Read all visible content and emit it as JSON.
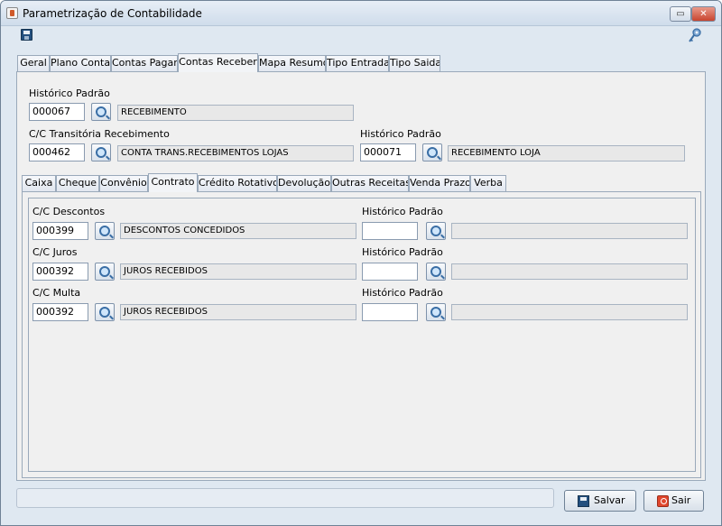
{
  "window": {
    "title": "Parametrização de Contabilidade",
    "minimize_label": "▭",
    "close_label": "✕"
  },
  "toolbar": {
    "save_icon": "save-icon",
    "key_icon": "key-icon"
  },
  "main_tabs": [
    {
      "label": "Geral"
    },
    {
      "label": "Plano Conta"
    },
    {
      "label": "Contas Pagar"
    },
    {
      "label": "Contas Receber"
    },
    {
      "label": "Mapa Resumo"
    },
    {
      "label": "Tipo Entrada"
    },
    {
      "label": "Tipo Saida"
    }
  ],
  "active_main_tab": "Contas Receber",
  "contas_receber": {
    "historico_padrao": {
      "label": "Histórico Padrão",
      "code": "000067",
      "description": "RECEBIMENTO"
    },
    "cc_transitoria": {
      "label": "C/C Transitória Recebimento",
      "code": "000462",
      "description": "CONTA TRANS.RECEBIMENTOS LOJAS"
    },
    "historico_transitoria": {
      "label": "Histórico Padrão",
      "code": "000071",
      "description": "RECEBIMENTO LOJA"
    }
  },
  "sub_tabs": [
    {
      "label": "Caixa"
    },
    {
      "label": "Cheque"
    },
    {
      "label": "Convênio"
    },
    {
      "label": "Contrato"
    },
    {
      "label": "Crédito Rotativo"
    },
    {
      "label": "Devolução"
    },
    {
      "label": "Outras Receitas"
    },
    {
      "label": "Venda Prazo"
    },
    {
      "label": "Verba"
    }
  ],
  "active_sub_tab": "Contrato",
  "contrato": {
    "descontos": {
      "label": "C/C Descontos",
      "code": "000399",
      "description": "DESCONTOS CONCEDIDOS",
      "historico_label": "Histórico Padrão",
      "historico_code": "",
      "historico_description": ""
    },
    "juros": {
      "label": "C/C Juros",
      "code": "000392",
      "description": "JUROS RECEBIDOS",
      "historico_label": "Histórico Padrão",
      "historico_code": "",
      "historico_description": ""
    },
    "multa": {
      "label": "C/C Multa",
      "code": "000392",
      "description": "JUROS RECEBIDOS",
      "historico_label": "Histórico Padrão",
      "historico_code": "",
      "historico_description": ""
    }
  },
  "footer": {
    "save_label": "Salvar",
    "exit_label": "Sair"
  }
}
